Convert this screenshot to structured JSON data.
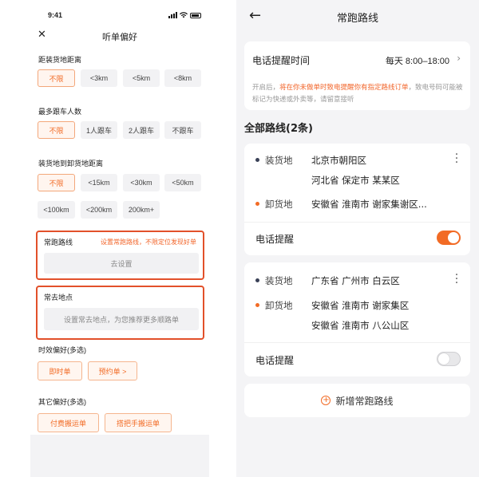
{
  "left": {
    "status_time": "9:41",
    "header_title": "听单偏好",
    "distance_label": "距装货地距离",
    "distance_options": [
      "不限",
      "<3km",
      "<5km",
      "<8km"
    ],
    "followers_label": "最多跟车人数",
    "followers_options": [
      "不限",
      "1人跟车",
      "2人跟车",
      "不跟车"
    ],
    "route_distance_label": "装货地到卸货地距离",
    "route_distance_options": [
      "不限",
      "<15km",
      "<30km",
      "<50km",
      "<100km",
      "<200km",
      "200km+"
    ],
    "frequent_routes": {
      "title": "常跑路线",
      "hint": "设置常跑路线，不限定位发现好单",
      "button": "去设置"
    },
    "frequent_places": {
      "title": "常去地点",
      "button": "设置常去地点，为您推荐更多顺路单"
    },
    "time_pref_label": "时效偏好(多选)",
    "time_pref_options": [
      "即时单",
      "预约单 >"
    ],
    "other_pref_label": "其它偏好(多选)",
    "other_pref_options": [
      "付费搬运单",
      "搭把手搬运单"
    ]
  },
  "right": {
    "header_title": "常跑路线",
    "reminder": {
      "title": "电话提醒时间",
      "value": "每天 8:00–18:00",
      "note_prefix": "开启后，",
      "note_highlight": "将在你未做单时致电提醒你有指定路线订单",
      "note_suffix": "，致电号码可能被标记为快递或外卖等，请留意接听"
    },
    "all_routes_title": "全部路线(2条)",
    "routes": [
      {
        "load_label": "装货地",
        "load_lines": [
          "北京市朝阳区",
          "河北省 保定市 某某区"
        ],
        "unload_label": "卸货地",
        "unload_lines": [
          "安徽省 淮南市 谢家集谢区..."
        ],
        "call_label": "电话提醒",
        "call_on": true
      },
      {
        "load_label": "装货地",
        "load_lines": [
          "广东省 广州市 白云区"
        ],
        "unload_label": "卸货地",
        "unload_lines": [
          "安徽省 淮南市 谢家集区",
          "安徽省 淮南市 八公山区"
        ],
        "call_label": "电话提醒",
        "call_on": false
      }
    ],
    "add_route": "新增常跑路线"
  },
  "colors": {
    "accent": "#f26b25",
    "highlight_box": "#e2502a",
    "load_dot": "#3a4157",
    "unload_dot": "#f26b25"
  }
}
